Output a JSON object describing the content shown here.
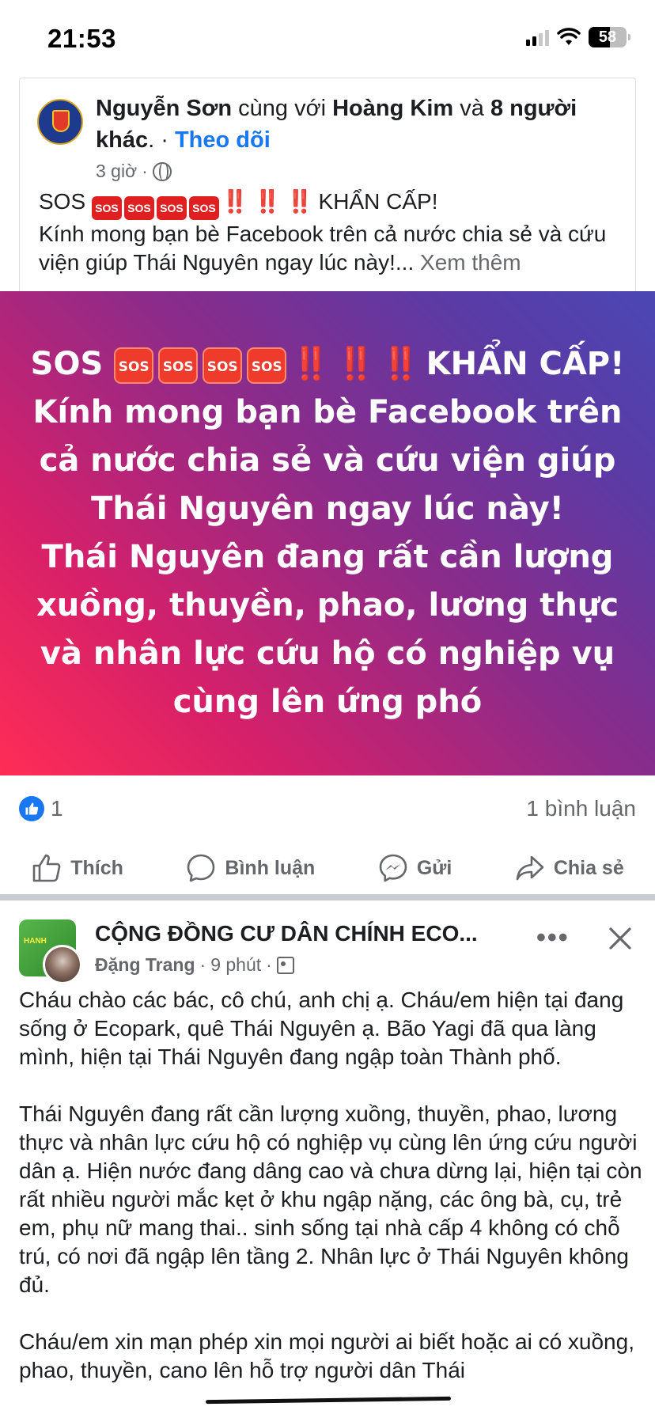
{
  "status_bar": {
    "time": "21:53",
    "battery": "58"
  },
  "post1": {
    "author": "Nguyễn Sơn",
    "with_text": "cùng với",
    "with_name": "Hoàng Kim",
    "and_text": "và",
    "others": "8 người khác",
    "dot": ".",
    "sep": " · ",
    "follow": "Theo dõi",
    "time": "3 giờ",
    "meta_sep": "·",
    "sos_label": "SOS",
    "sos_icon": "SOS",
    "bang": "‼️",
    "urgent": "KHẨN CẤP!",
    "body": " Kính mong bạn bè Facebook trên cả nước chia sẻ và cứu viện giúp Thái Nguyên ngay lúc này!...",
    "see_more": "Xem thêm",
    "banner_lines": [
      "Kính mong bạn bè Facebook trên",
      "cả nước chia sẻ và cứu viện giúp",
      "Thái Nguyên ngay lúc này!",
      "Thái Nguyên đang rất cần lượng",
      "xuồng, thuyền, phao, lương thực",
      "và nhân lực cứu hộ có nghiệp vụ",
      "cùng lên ứng phó"
    ],
    "like_count": "1",
    "comment_count": "1 bình luận",
    "gradient": [
      "#ff2d55",
      "#d6206a",
      "#8c2b8a",
      "#5c3aa4",
      "#4b47b4"
    ]
  },
  "actions": {
    "like": "Thích",
    "comment": "Bình luận",
    "send": "Gửi",
    "share": "Chia sẻ"
  },
  "post2": {
    "group": "CỘNG ĐỒNG CƯ DÂN CHÍNH ECO...",
    "author": "Đặng Trang",
    "time": "9 phút",
    "meta_sep": "·",
    "group_avatar_text": "HANH",
    "more": "•••",
    "paragraphs": [
      "Cháu chào các bác, cô chú, anh chị ạ. Cháu/em hiện tại đang sống ở Ecopark, quê Thái Nguyên ạ. Bão Yagi đã qua làng mình, hiện tại Thái Nguyên đang ngập toàn Thành phố.",
      "Thái Nguyên đang rất cần lượng xuồng, thuyền, phao, lương thực và nhân lực cứu hộ có nghiệp vụ cùng lên ứng cứu người dân ạ. Hiện nước đang dâng cao và chưa dừng lại, hiện tại còn rất nhiều người mắc kẹt ở khu ngập nặng, các ông bà, cụ, trẻ em, phụ nữ mang thai.. sinh sống tại nhà cấp 4 không có chỗ trú, có nơi đã ngập lên tầng 2. Nhân lực ở Thái Nguyên không đủ.",
      "Cháu/em xin mạn phép xin mọi người ai biết hoặc ai có xuồng, phao, thuyền, cano lên hỗ trợ người dân Thái"
    ]
  },
  "colors": {
    "link": "#1877f2",
    "secondary": "#65676b",
    "sos_red": "#e02020"
  },
  "icons": [
    "signal-icon",
    "wifi-icon",
    "battery-icon",
    "globe-icon",
    "like-icon",
    "comment-icon",
    "messenger-icon",
    "share-icon",
    "close-icon",
    "more-icon"
  ]
}
